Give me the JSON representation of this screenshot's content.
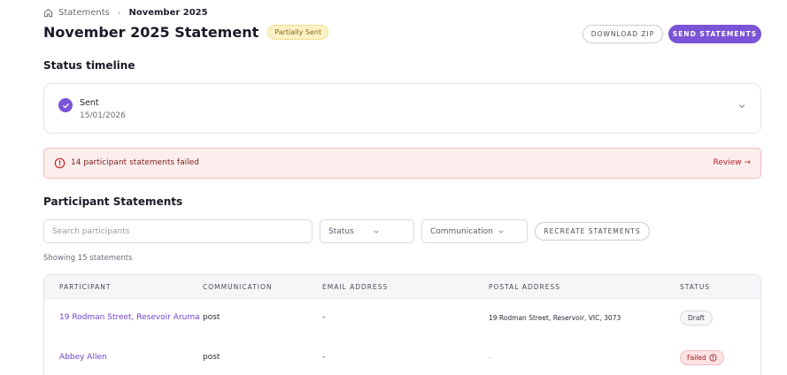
{
  "breadcrumb": {
    "home_icon": "home-icon",
    "root": "Statements",
    "separator_icon": "chevron-right-icon",
    "current": "November 2025"
  },
  "header": {
    "title": "November 2025 Statement",
    "status_badge": "Partially Sent",
    "download_label": "DOWNLOAD ZIP",
    "send_label": "SEND STATEMENTS"
  },
  "timeline": {
    "section_title": "Status timeline",
    "entry_label": "Sent",
    "entry_date": "15/01/2026",
    "check_icon": "check-icon",
    "expand_icon": "chevron-down-icon"
  },
  "alert": {
    "icon": "alert-circle-icon",
    "message": "14 participant statements failed",
    "action": "Review →"
  },
  "participants": {
    "section_title": "Participant Statements",
    "search_placeholder": "Search participants",
    "status_filter": "Status",
    "communication_filter": "Communication",
    "recreate_label": "RECREATE STATEMENTS",
    "showing": "Showing 15 statements",
    "columns": [
      "PARTICIPANT",
      "COMMUNICATION",
      "EMAIL ADDRESS",
      "POSTAL ADDRESS",
      "STATUS"
    ],
    "rows": [
      {
        "participant": "19 Rodman Street, Resevoir Aruma",
        "communication": "post",
        "email": "-",
        "postal": "19 Rodman Street, Reservoir, VIC, 3073",
        "status": "Draft"
      },
      {
        "participant": "Abbey Allen",
        "communication": "post",
        "email": "-",
        "postal": "-",
        "status": "Failed"
      }
    ]
  },
  "colors": {
    "accent": "#7b53d6",
    "alert_bg": "#fdeeee",
    "alert_text": "#b4232a",
    "badge_bg": "#fdf1c7"
  }
}
